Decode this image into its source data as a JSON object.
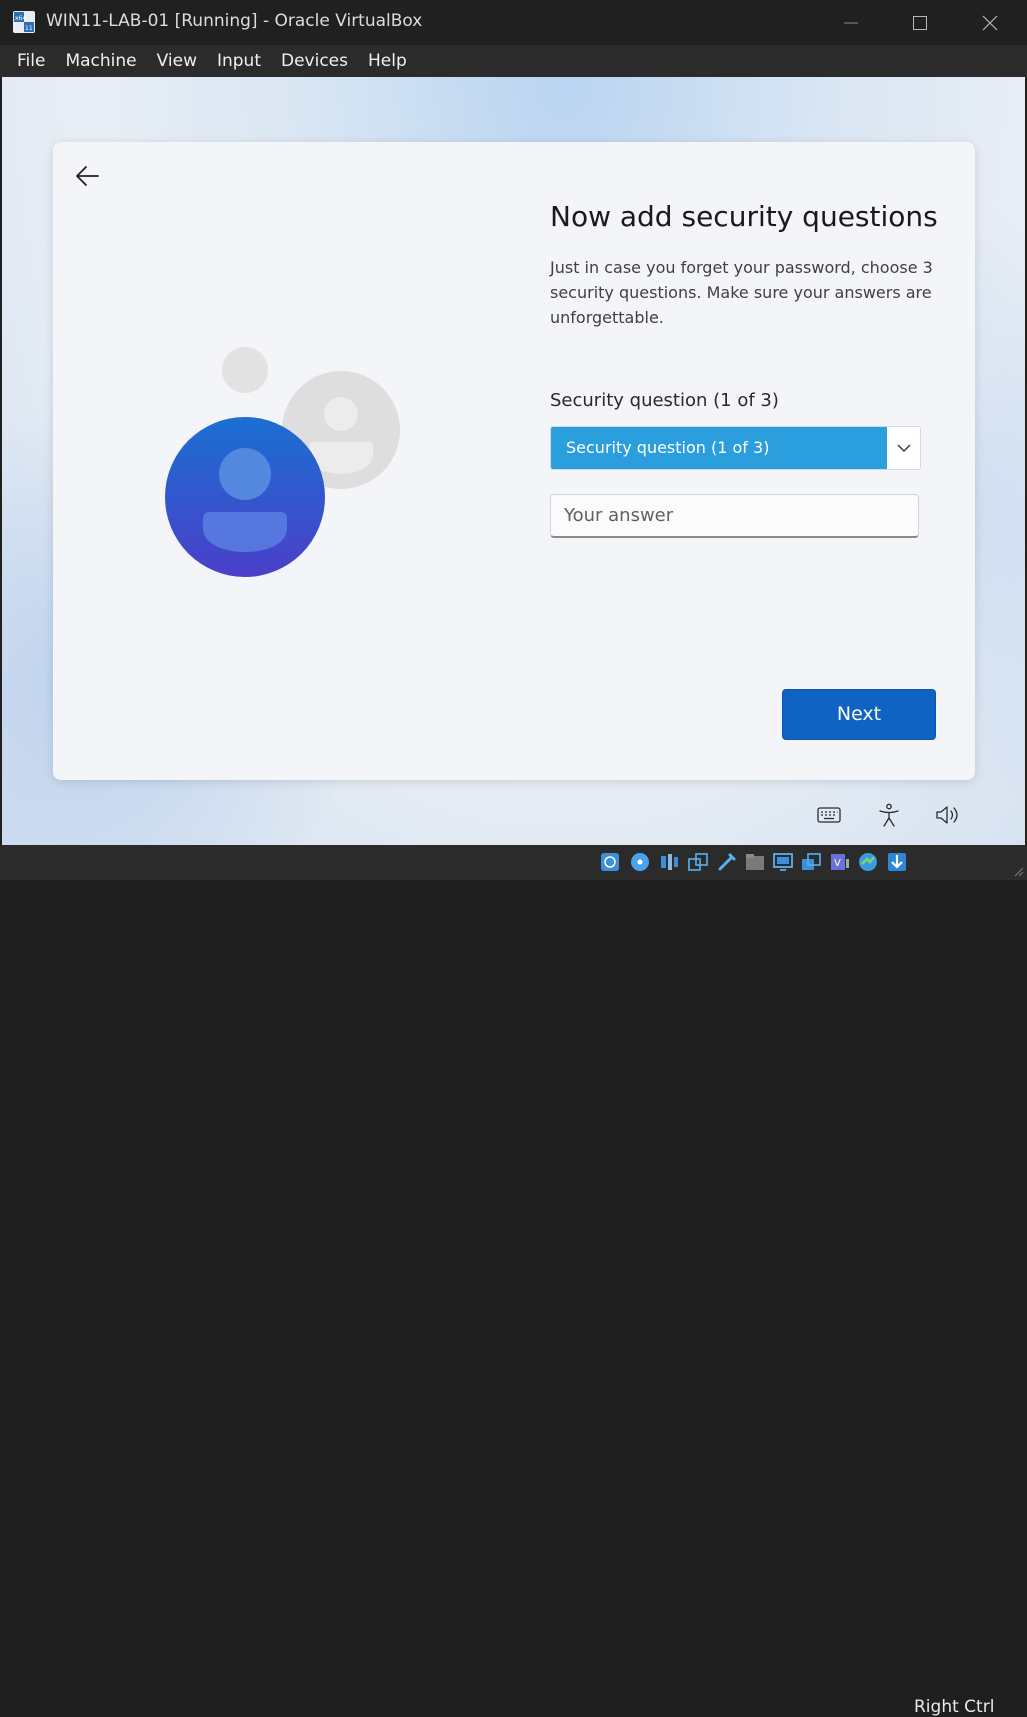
{
  "window": {
    "title": "WIN11-LAB-01 [Running] - Oracle VirtualBox",
    "app_icon": "virtualbox-icon",
    "controls": [
      "minimize-icon",
      "maximize-icon",
      "close-icon"
    ]
  },
  "menubar": {
    "items": [
      "File",
      "Machine",
      "View",
      "Input",
      "Devices",
      "Help"
    ]
  },
  "oobe": {
    "heading": "Now add security questions",
    "description": "Just in case you forget your password, choose 3 security questions. Make sure your answers are unforgettable.",
    "question_label": "Security question (1 of 3)",
    "question_select_value": "Security question (1 of 3)",
    "answer_placeholder": "Your answer",
    "next_label": "Next",
    "bottom_icons": [
      "keyboard-icon",
      "accessibility-icon",
      "volume-icon"
    ],
    "accent_color": "#2b9fdd",
    "button_color": "#0f63c2"
  },
  "statusbar": {
    "icons": [
      "hard-disk-icon",
      "optical-drive-icon",
      "audio-icon",
      "network-icon",
      "usb-icon",
      "shared-folders-icon",
      "display-icon",
      "capture-icon",
      "recording-icon",
      "vt-x-icon",
      "guest-additions-icon",
      "mouse-integration-icon"
    ],
    "host_key": "Right Ctrl"
  }
}
